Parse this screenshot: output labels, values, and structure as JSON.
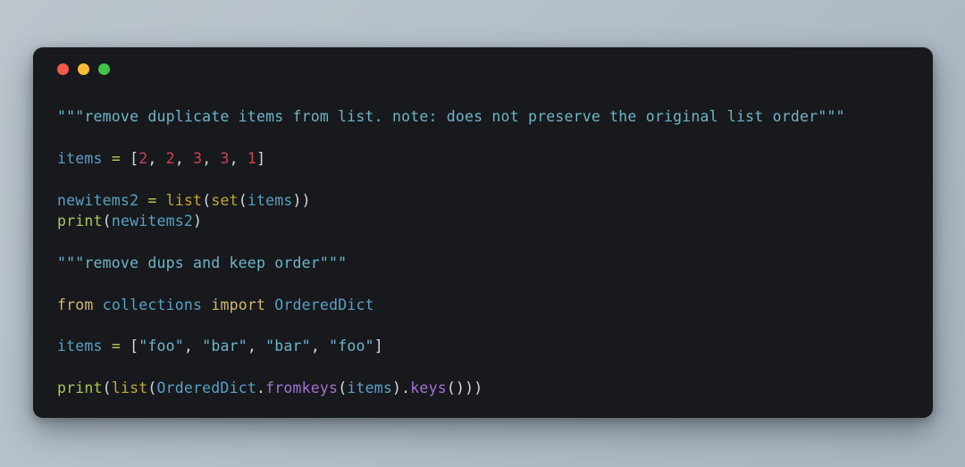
{
  "window": {
    "background_color": "#17191c",
    "page_background_color": "#b5bfc8",
    "traffic_lights": [
      {
        "name": "close",
        "color": "#f2594b"
      },
      {
        "name": "minimize",
        "color": "#f6bd3b"
      },
      {
        "name": "zoom",
        "color": "#3fc54a"
      }
    ]
  },
  "theme": {
    "string": "#6fb4c9",
    "keyword": "#d5b872",
    "builtin": "#c5a53a",
    "function": "#a9c75a",
    "method": "#a472d6",
    "variable": "#5aa0c4",
    "number": "#cf4156",
    "operator": "#c7c95c",
    "plain": "#d6dbe0"
  },
  "code": {
    "language": "python",
    "plain_text": "\"\"\"remove duplicate items from list. note: does not preserve the original list order\"\"\"\n\nitems = [2, 2, 3, 3, 1]\n\nnewitems2 = list(set(items))\nprint(newitems2)\n\n\"\"\"remove dups and keep order\"\"\"\n\nfrom collections import OrderedDict\n\nitems = [\"foo\", \"bar\", \"bar\", \"foo\"]\n\nprint(list(OrderedDict.fromkeys(items).keys()))",
    "lines": [
      {
        "index": 1,
        "tokens": [
          {
            "t": "\"\"\"remove duplicate items from list. note: does not preserve the original list order\"\"\"",
            "c": "string"
          }
        ]
      },
      {
        "index": 2,
        "tokens": []
      },
      {
        "index": 3,
        "tokens": [
          {
            "t": "items",
            "c": "variable"
          },
          {
            "t": " ",
            "c": "plain"
          },
          {
            "t": "=",
            "c": "operator"
          },
          {
            "t": " ",
            "c": "plain"
          },
          {
            "t": "[",
            "c": "plain"
          },
          {
            "t": "2",
            "c": "number"
          },
          {
            "t": ", ",
            "c": "plain"
          },
          {
            "t": "2",
            "c": "number"
          },
          {
            "t": ", ",
            "c": "plain"
          },
          {
            "t": "3",
            "c": "number"
          },
          {
            "t": ", ",
            "c": "plain"
          },
          {
            "t": "3",
            "c": "number"
          },
          {
            "t": ", ",
            "c": "plain"
          },
          {
            "t": "1",
            "c": "number"
          },
          {
            "t": "]",
            "c": "plain"
          }
        ]
      },
      {
        "index": 4,
        "tokens": []
      },
      {
        "index": 5,
        "tokens": [
          {
            "t": "newitems2",
            "c": "variable"
          },
          {
            "t": " ",
            "c": "plain"
          },
          {
            "t": "=",
            "c": "operator"
          },
          {
            "t": " ",
            "c": "plain"
          },
          {
            "t": "list",
            "c": "builtin"
          },
          {
            "t": "(",
            "c": "plain"
          },
          {
            "t": "set",
            "c": "builtin"
          },
          {
            "t": "(",
            "c": "plain"
          },
          {
            "t": "items",
            "c": "variable"
          },
          {
            "t": "))",
            "c": "plain"
          }
        ]
      },
      {
        "index": 6,
        "tokens": [
          {
            "t": "print",
            "c": "function"
          },
          {
            "t": "(",
            "c": "plain"
          },
          {
            "t": "newitems2",
            "c": "variable"
          },
          {
            "t": ")",
            "c": "plain"
          }
        ]
      },
      {
        "index": 7,
        "tokens": []
      },
      {
        "index": 8,
        "tokens": [
          {
            "t": "\"\"\"remove dups and keep order\"\"\"",
            "c": "string"
          }
        ]
      },
      {
        "index": 9,
        "tokens": []
      },
      {
        "index": 10,
        "tokens": [
          {
            "t": "from",
            "c": "keyword"
          },
          {
            "t": " ",
            "c": "plain"
          },
          {
            "t": "collections",
            "c": "variable"
          },
          {
            "t": " ",
            "c": "plain"
          },
          {
            "t": "import",
            "c": "keyword"
          },
          {
            "t": " ",
            "c": "plain"
          },
          {
            "t": "OrderedDict",
            "c": "variable"
          }
        ]
      },
      {
        "index": 11,
        "tokens": []
      },
      {
        "index": 12,
        "tokens": [
          {
            "t": "items",
            "c": "variable"
          },
          {
            "t": " ",
            "c": "plain"
          },
          {
            "t": "=",
            "c": "operator"
          },
          {
            "t": " ",
            "c": "plain"
          },
          {
            "t": "[",
            "c": "plain"
          },
          {
            "t": "\"foo\"",
            "c": "string"
          },
          {
            "t": ", ",
            "c": "plain"
          },
          {
            "t": "\"bar\"",
            "c": "string"
          },
          {
            "t": ", ",
            "c": "plain"
          },
          {
            "t": "\"bar\"",
            "c": "string"
          },
          {
            "t": ", ",
            "c": "plain"
          },
          {
            "t": "\"foo\"",
            "c": "string"
          },
          {
            "t": "]",
            "c": "plain"
          }
        ]
      },
      {
        "index": 13,
        "tokens": []
      },
      {
        "index": 14,
        "tokens": [
          {
            "t": "print",
            "c": "function"
          },
          {
            "t": "(",
            "c": "plain"
          },
          {
            "t": "list",
            "c": "builtin"
          },
          {
            "t": "(",
            "c": "plain"
          },
          {
            "t": "OrderedDict",
            "c": "variable"
          },
          {
            "t": ".",
            "c": "plain"
          },
          {
            "t": "fromkeys",
            "c": "method"
          },
          {
            "t": "(",
            "c": "plain"
          },
          {
            "t": "items",
            "c": "variable"
          },
          {
            "t": ")",
            "c": "plain"
          },
          {
            "t": ".",
            "c": "plain"
          },
          {
            "t": "keys",
            "c": "method"
          },
          {
            "t": "()))",
            "c": "plain"
          }
        ]
      }
    ]
  }
}
